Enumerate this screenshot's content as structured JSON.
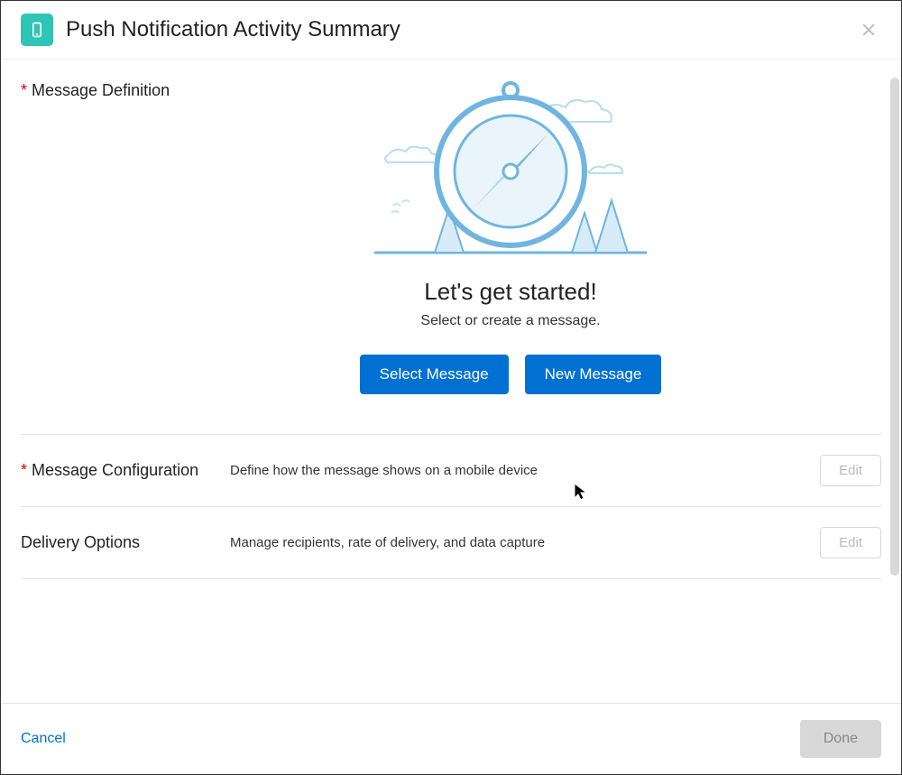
{
  "header": {
    "title": "Push Notification Activity Summary"
  },
  "sections": {
    "definition": {
      "label": "Message Definition",
      "heroTitle": "Let's get started!",
      "heroSub": "Select or create a message.",
      "selectBtn": "Select Message",
      "newBtn": "New Message"
    },
    "configuration": {
      "label": "Message Configuration",
      "desc": "Define how the message shows on a mobile device",
      "editBtn": "Edit"
    },
    "delivery": {
      "label": "Delivery Options",
      "desc": "Manage recipients, rate of delivery, and data capture",
      "editBtn": "Edit"
    }
  },
  "footer": {
    "cancel": "Cancel",
    "done": "Done"
  }
}
